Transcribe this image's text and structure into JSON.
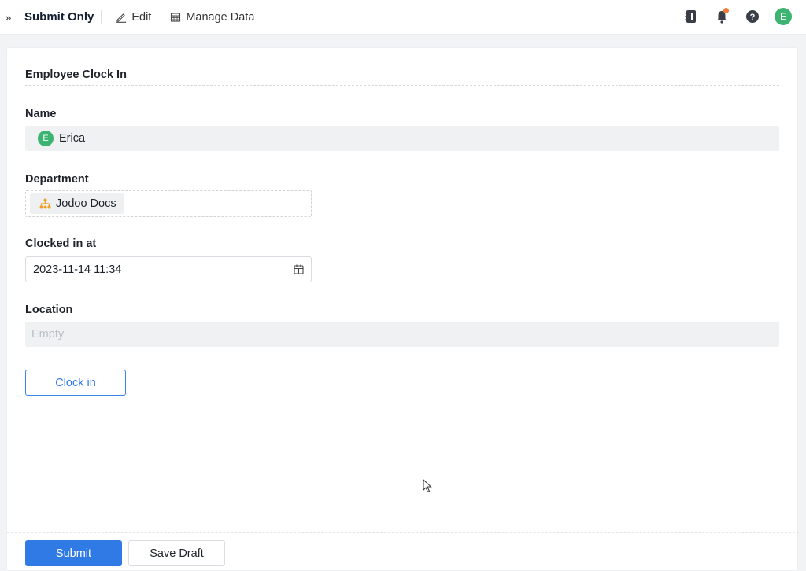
{
  "topbar": {
    "expand_icon": "double-chevron-right",
    "form_title": "Submit Only",
    "tools": [
      {
        "label": "Edit",
        "icon": "pencil-icon"
      },
      {
        "label": "Manage Data",
        "icon": "table-icon"
      }
    ],
    "right_icons": [
      "notebook-icon",
      "bell-icon",
      "help-icon",
      "user-avatar"
    ],
    "avatar_initial": "E",
    "notification_dot": true
  },
  "form": {
    "section_title": "Employee Clock In",
    "fields": {
      "name": {
        "label": "Name",
        "value": "Erica",
        "avatar_initial": "E"
      },
      "department": {
        "label": "Department",
        "value": "Jodoo Docs"
      },
      "clocked_in_at": {
        "label": "Clocked in at",
        "value": "2023-11-14 11:34"
      },
      "location": {
        "label": "Location",
        "placeholder": "Empty"
      }
    },
    "clock_in_button": "Clock in"
  },
  "footer": {
    "submit": "Submit",
    "save_draft": "Save Draft"
  },
  "colors": {
    "primary": "#2f7ae5",
    "avatar": "#3cb371",
    "dept_icon": "#f0a020",
    "notification": "#f07a3a"
  }
}
